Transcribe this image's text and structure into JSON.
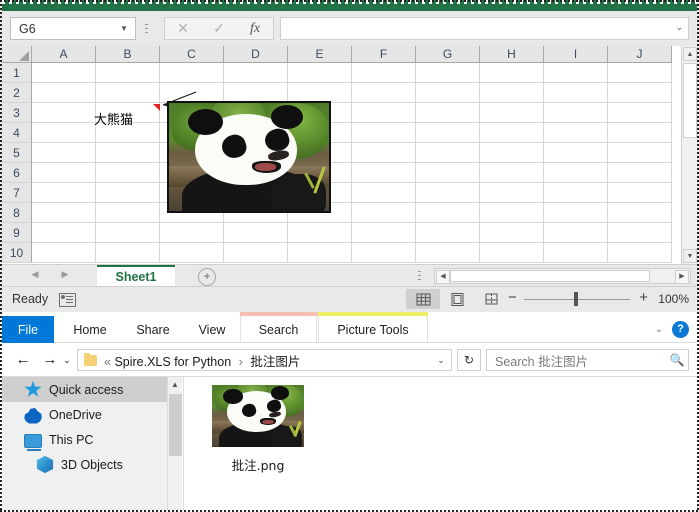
{
  "excel": {
    "title_bar_color": "#217346",
    "name_box": {
      "value": "G6",
      "dropdown_icon": "chevron-down-icon"
    },
    "formula_bar": {
      "cancel_icon": "cancel-x-icon",
      "enter_icon": "check-icon",
      "function_icon": "fx-icon",
      "value": "",
      "expand_icon": "chevron-down-icon"
    },
    "columns": [
      "A",
      "B",
      "C",
      "D",
      "E",
      "F",
      "G",
      "H",
      "I",
      "J"
    ],
    "rows": [
      "1",
      "2",
      "3",
      "4",
      "5",
      "6",
      "7",
      "8",
      "9",
      "10"
    ],
    "cell_text": "大熊猫",
    "comment_indicator": "comment-triangle-icon",
    "picture_alt": "giant-panda-photo",
    "sheet_tabs": {
      "tabs": [
        "Sheet1"
      ],
      "add_label": "+",
      "prev_icon": "prev-sheet-icon",
      "next_icon": "next-sheet-icon"
    },
    "status": {
      "text": "Ready",
      "macro_icon": "record-macro-icon",
      "view_normal": "normal-view-icon",
      "view_layout": "page-layout-view-icon",
      "view_break": "page-break-view-icon",
      "zoom_out": "−",
      "zoom_in": "+",
      "zoom_level": "100%"
    }
  },
  "explorer": {
    "ribbon": {
      "file_label": "File",
      "tabs": [
        "Home",
        "Share",
        "View"
      ],
      "contextual": [
        {
          "label": "Search",
          "color": "#f6bfb4"
        },
        {
          "label": "Picture Tools",
          "color": "#eeee66"
        }
      ],
      "collapse_icon": "chevron-down-icon",
      "help_icon": "help-icon",
      "help_label": "?"
    },
    "address": {
      "back_icon": "back-arrow-icon",
      "forward_icon": "forward-arrow-icon",
      "recent_icon": "recent-locations-icon",
      "up_icon": "up-arrow-icon",
      "folder_icon": "folder-icon",
      "overflow": "«",
      "crumbs": [
        "Spire.XLS for Python",
        "批注图片"
      ],
      "separator": "›",
      "dropdown_icon": "chevron-down-icon",
      "refresh_icon": "refresh-icon",
      "refresh_glyph": "↻",
      "search_placeholder": "Search 批注图片",
      "search_icon": "search-icon"
    },
    "nav_pane": {
      "items": [
        {
          "label": "Quick access",
          "icon": "pin-star-icon",
          "selected": true,
          "indent": false
        },
        {
          "label": "OneDrive",
          "icon": "onedrive-cloud-icon",
          "selected": false,
          "indent": false
        },
        {
          "label": "This PC",
          "icon": "this-pc-icon",
          "selected": false,
          "indent": false
        },
        {
          "label": "3D Objects",
          "icon": "3d-objects-icon",
          "selected": false,
          "indent": true
        }
      ],
      "scroll_up_icon": "scroll-up-icon"
    },
    "files": [
      {
        "name": "批注.png",
        "thumb": "giant-panda-photo"
      }
    ]
  }
}
